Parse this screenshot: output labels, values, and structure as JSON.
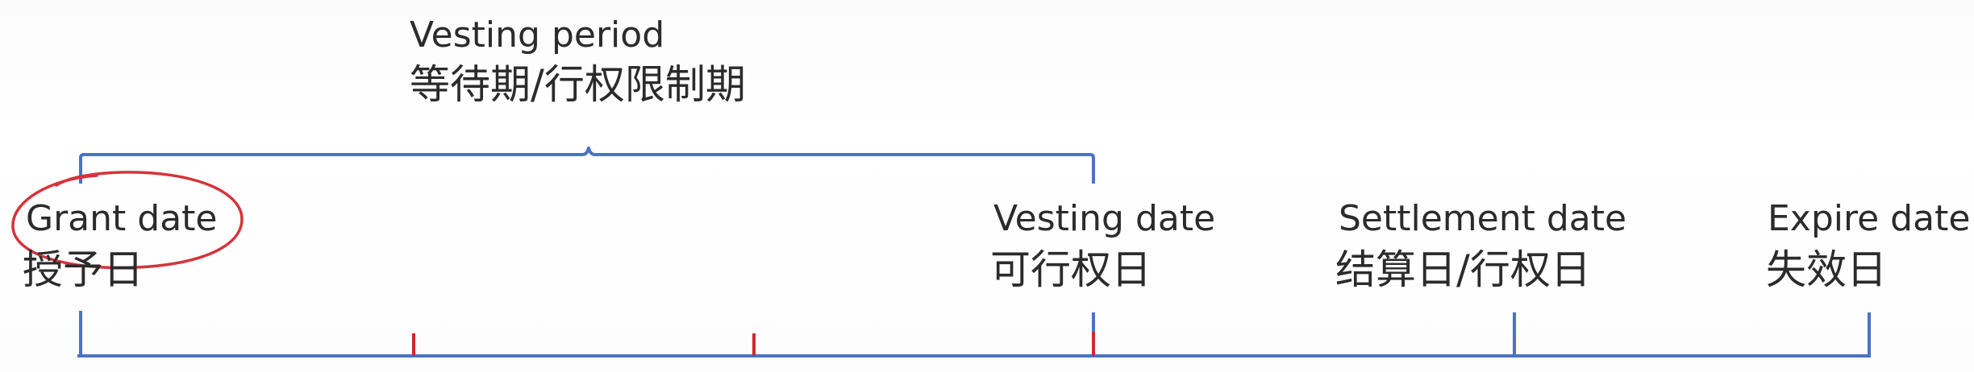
{
  "vesting_period": {
    "en": "Vesting period",
    "zh": "等待期/行权限制期"
  },
  "milestones": [
    {
      "en": "Grant date",
      "zh": "授予日",
      "highlighted": true
    },
    {
      "en": "Vesting date",
      "zh": "可行权日"
    },
    {
      "en": "Settlement date",
      "zh": "结算日/行权日"
    },
    {
      "en": "Expire date",
      "zh": "失效日"
    }
  ],
  "colors": {
    "timeline": "#4a73c4",
    "tick_minor": "#d0282c",
    "highlight": "#d6333b",
    "text": "#2b2b2b"
  }
}
